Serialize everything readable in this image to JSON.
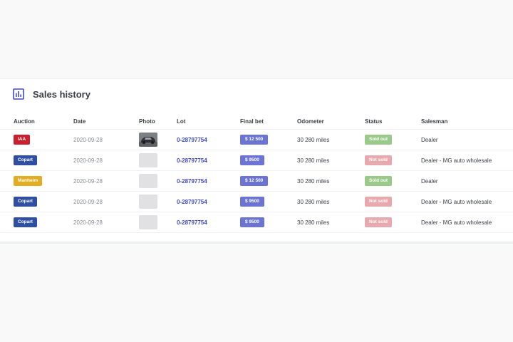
{
  "section": {
    "title": "Sales history",
    "icon": "bar-chart-icon",
    "accent_color": "#3d49c9"
  },
  "table": {
    "columns": [
      "Auction",
      "Date",
      "Photo",
      "Lot",
      "Final bet",
      "Odometer",
      "Status",
      "Salesman"
    ],
    "rows": [
      {
        "auction": "IAA",
        "auction_color": "#c8202e",
        "date": "2020-09-28",
        "photo": "car-photo",
        "lot": "0-28797754",
        "final_bet": "$ 12 500",
        "odometer": "30 280 miles",
        "status": "Sold out",
        "status_color": "#9bc98a",
        "salesman": "Dealer"
      },
      {
        "auction": "Copart",
        "auction_color": "#2f4fa3",
        "date": "2020-09-28",
        "photo": "photo-placeholder",
        "lot": "0-28797754",
        "final_bet": "$ 9500",
        "odometer": "30 280 miles",
        "status": "Not sold",
        "status_color": "#e7a9ad",
        "salesman": "Dealer - MG auto wholesale"
      },
      {
        "auction": "Manheim",
        "auction_color": "#e3ad21",
        "date": "2020-09-28",
        "photo": "photo-placeholder",
        "lot": "0-28797754",
        "final_bet": "$ 12 500",
        "odometer": "30 280 miles",
        "status": "Sold out",
        "status_color": "#9bc98a",
        "salesman": "Dealer"
      },
      {
        "auction": "Copart",
        "auction_color": "#2f4fa3",
        "date": "2020-09-28",
        "photo": "photo-placeholder",
        "lot": "0-28797754",
        "final_bet": "$ 9500",
        "odometer": "30 280 miles",
        "status": "Not sold",
        "status_color": "#e7a9ad",
        "salesman": "Dealer - MG auto wholesale"
      },
      {
        "auction": "Copart",
        "auction_color": "#2f4fa3",
        "date": "2020-09-28",
        "photo": "photo-placeholder",
        "lot": "0-28797754",
        "final_bet": "$ 9500",
        "odometer": "30 280 miles",
        "status": "Not sold",
        "status_color": "#e7a9ad",
        "salesman": "Dealer - MG auto wholesale"
      }
    ]
  }
}
